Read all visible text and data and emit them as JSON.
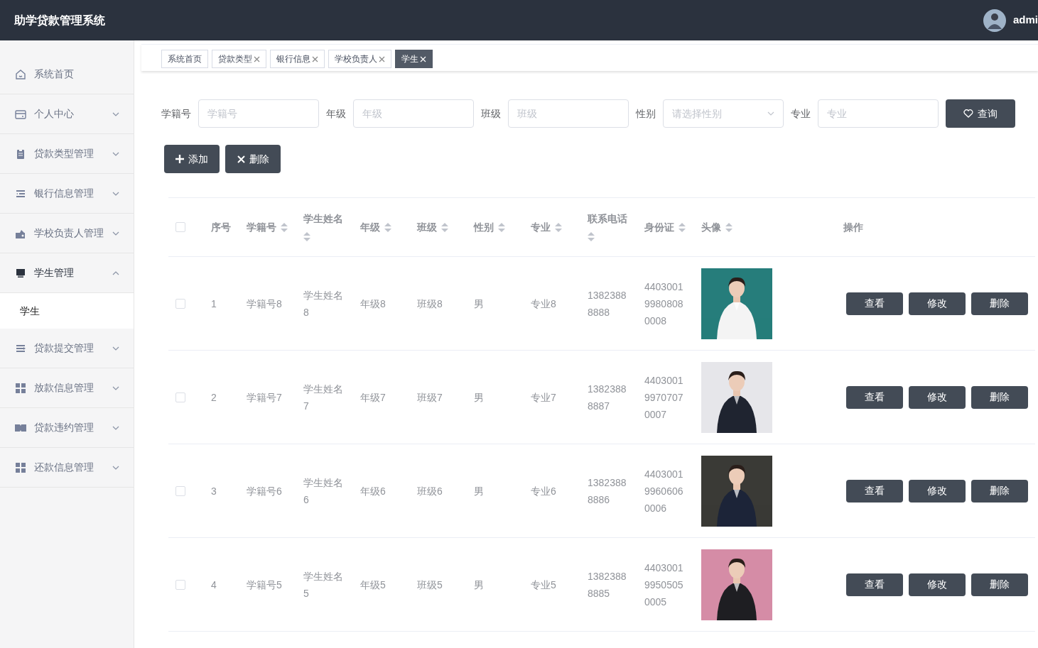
{
  "header": {
    "title": "助学贷款管理系统",
    "user": "admi"
  },
  "sidebar": {
    "items": [
      {
        "label": "系统首页",
        "kind": "link",
        "expanded": false
      },
      {
        "label": "个人中心",
        "kind": "group",
        "expanded": false
      },
      {
        "label": "贷款类型管理",
        "kind": "group",
        "expanded": false
      },
      {
        "label": "银行信息管理",
        "kind": "group",
        "expanded": false
      },
      {
        "label": "学校负责人管理",
        "kind": "group",
        "expanded": false
      },
      {
        "label": "学生管理",
        "kind": "group",
        "expanded": true,
        "children": [
          {
            "label": "学生",
            "selected": true
          }
        ]
      },
      {
        "label": "贷款提交管理",
        "kind": "group",
        "expanded": false
      },
      {
        "label": "放款信息管理",
        "kind": "group",
        "expanded": false
      },
      {
        "label": "贷款违约管理",
        "kind": "group",
        "expanded": false
      },
      {
        "label": "还款信息管理",
        "kind": "group",
        "expanded": false
      }
    ]
  },
  "tabs": [
    {
      "label": "系统首页",
      "closable": false,
      "selected": false
    },
    {
      "label": "贷款类型",
      "closable": true,
      "selected": false
    },
    {
      "label": "银行信息",
      "closable": true,
      "selected": false
    },
    {
      "label": "学校负责人",
      "closable": true,
      "selected": false
    },
    {
      "label": "学生",
      "closable": true,
      "selected": true
    }
  ],
  "search": {
    "fields": [
      {
        "label": "学籍号",
        "placeholder": "学籍号",
        "kind": "input"
      },
      {
        "label": "年级",
        "placeholder": "年级",
        "kind": "input"
      },
      {
        "label": "班级",
        "placeholder": "班级",
        "kind": "input"
      },
      {
        "label": "性别",
        "placeholder": "请选择性别",
        "kind": "select"
      },
      {
        "label": "专业",
        "placeholder": "专业",
        "kind": "input"
      }
    ],
    "button": "查询"
  },
  "actions": [
    {
      "label": "添加",
      "kind": "add"
    },
    {
      "label": "删除",
      "kind": "delete"
    }
  ],
  "table": {
    "all_checked": false,
    "columns": [
      {
        "label": "序号",
        "sortable": false
      },
      {
        "label": "学籍号",
        "sortable": true
      },
      {
        "label": "学生姓名",
        "sortable": true
      },
      {
        "label": "年级",
        "sortable": true
      },
      {
        "label": "班级",
        "sortable": true
      },
      {
        "label": "性别",
        "sortable": true
      },
      {
        "label": "专业",
        "sortable": true
      },
      {
        "label": "联系电话",
        "sortable": true
      },
      {
        "label": "身份证",
        "sortable": true
      },
      {
        "label": "头像",
        "sortable": true
      },
      {
        "label": "操作",
        "sortable": false
      }
    ],
    "rows": [
      {
        "checked": false,
        "cells": [
          "1",
          "学籍号8",
          "学生姓名8",
          "年级8",
          "班级8",
          "男",
          "专业8",
          "13823888888",
          "440300199808080008"
        ],
        "avatar": {
          "kind": "picture"
        },
        "buttons": [
          "查看",
          "修改",
          "删除"
        ]
      },
      {
        "checked": false,
        "cells": [
          "2",
          "学籍号7",
          "学生姓名7",
          "年级7",
          "班级7",
          "男",
          "专业7",
          "13823888887",
          "440300199707070007"
        ],
        "avatar": {
          "kind": "picture"
        },
        "buttons": [
          "查看",
          "修改",
          "删除"
        ]
      },
      {
        "checked": false,
        "cells": [
          "3",
          "学籍号6",
          "学生姓名6",
          "年级6",
          "班级6",
          "男",
          "专业6",
          "13823888886",
          "440300199606060006"
        ],
        "avatar": {
          "kind": "picture"
        },
        "buttons": [
          "查看",
          "修改",
          "删除"
        ]
      },
      {
        "checked": false,
        "cells": [
          "4",
          "学籍号5",
          "学生姓名5",
          "年级5",
          "班级5",
          "男",
          "专业5",
          "13823888885",
          "440300199505050005"
        ],
        "avatar": {
          "kind": "picture"
        },
        "buttons": [
          "查看",
          "修改",
          "删除"
        ]
      }
    ]
  }
}
